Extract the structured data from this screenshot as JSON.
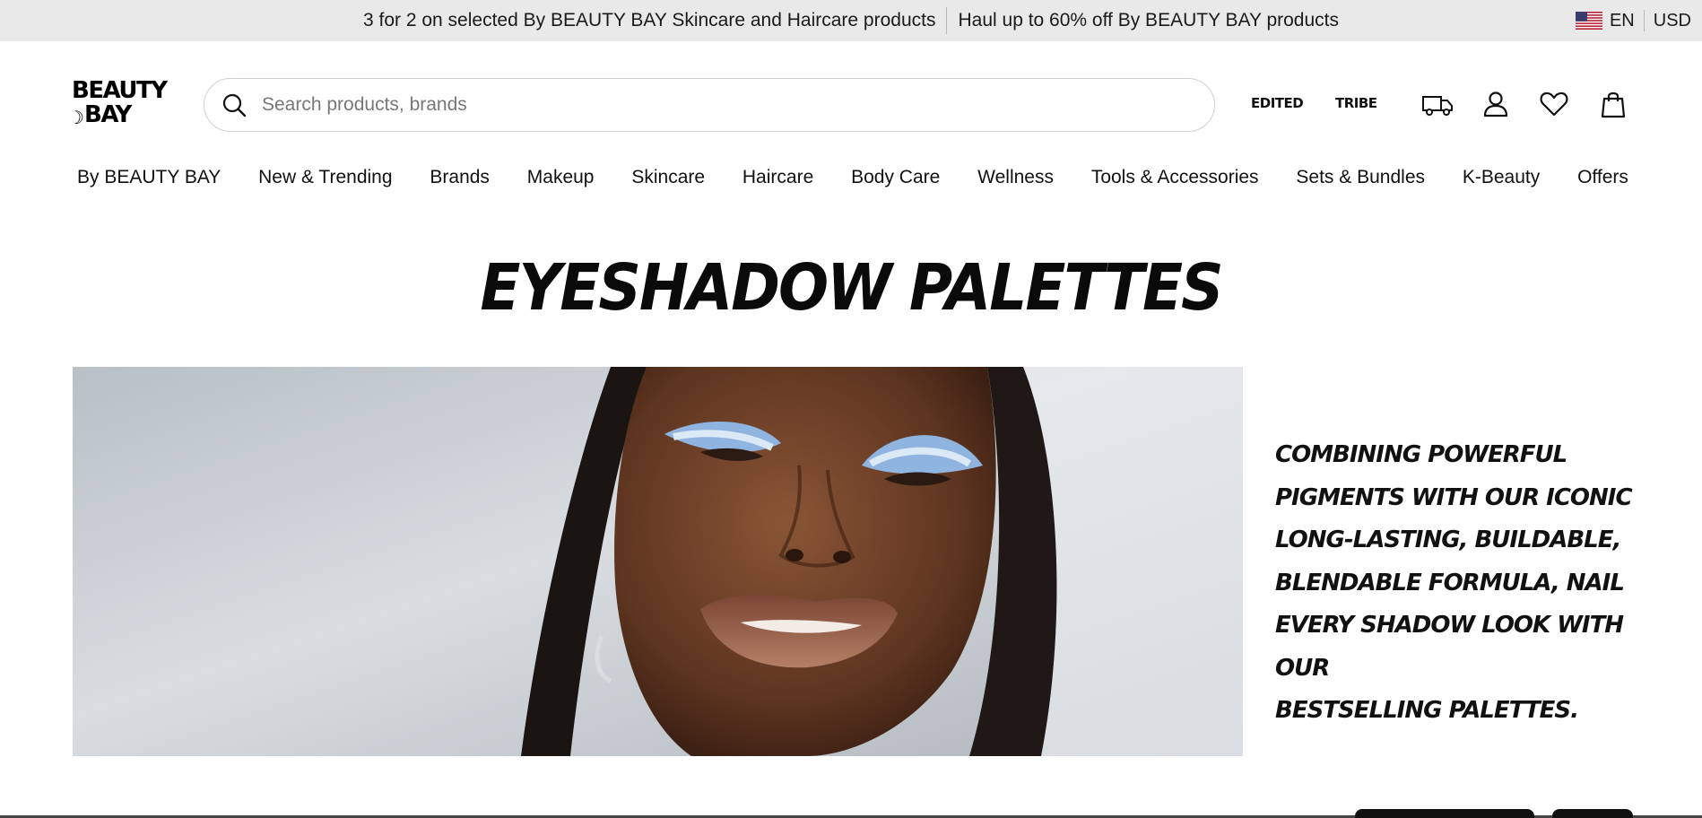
{
  "promo": {
    "messages": [
      "3 for 2 on selected By BEAUTY BAY Skincare and Haircare products",
      "Haul up to 60% off By BEAUTY BAY products"
    ],
    "language": "EN",
    "currency": "USD",
    "flag_icon": "us-flag-icon"
  },
  "header": {
    "logo_line1": "BEAUTY",
    "logo_line2": "BAY",
    "search": {
      "placeholder": "Search products, brands",
      "value": ""
    },
    "links": {
      "edited": "EDITED",
      "tribe": "TRIBE"
    },
    "icons": [
      "delivery-truck-icon",
      "account-icon",
      "wishlist-heart-icon",
      "shopping-bag-icon"
    ]
  },
  "nav": {
    "items": [
      "By BEAUTY BAY",
      "New & Trending",
      "Brands",
      "Makeup",
      "Skincare",
      "Haircare",
      "Body Care",
      "Wellness",
      "Tools & Accessories",
      "Sets & Bundles",
      "K-Beauty",
      "Offers"
    ]
  },
  "page": {
    "title": "EYESHADOW PALETTES",
    "description_lines": [
      "COMBINING POWERFUL",
      "PIGMENTS WITH OUR ICONIC",
      "LONG-LASTING, BUILDABLE,",
      "BLENDABLE FORMULA, NAIL",
      "EVERY SHADOW LOOK WITH OUR",
      "BESTSELLING PALETTES."
    ]
  },
  "colors": {
    "promo_bg": "#e9e9e9",
    "text": "#111111",
    "eyeshadow_blue": "#8fb4e0"
  }
}
